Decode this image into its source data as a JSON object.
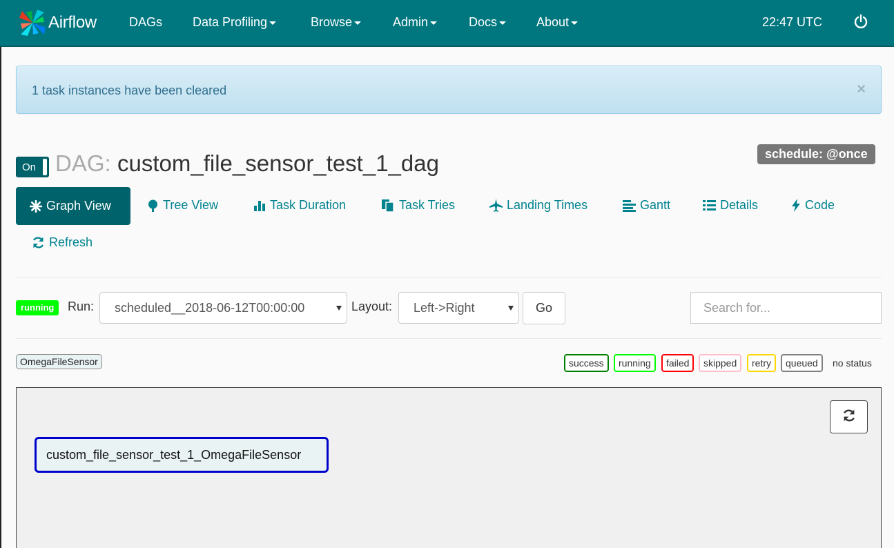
{
  "navbar": {
    "brand": "Airflow",
    "items": [
      {
        "label": "DAGs",
        "dropdown": false
      },
      {
        "label": "Data Profiling",
        "dropdown": true
      },
      {
        "label": "Browse",
        "dropdown": true
      },
      {
        "label": "Admin",
        "dropdown": true
      },
      {
        "label": "Docs",
        "dropdown": true
      },
      {
        "label": "About",
        "dropdown": true
      }
    ],
    "clock": "22:47 UTC",
    "power_icon": "power-icon",
    "color": "#00777f"
  },
  "alert": {
    "message": "1 task instances have been cleared",
    "close": "×"
  },
  "dag": {
    "toggle_label": "On",
    "prefix": "DAG:",
    "name": "custom_file_sensor_test_1_dag",
    "schedule": "schedule: @once"
  },
  "tabs": [
    {
      "label": "Graph View",
      "icon": "asterisk-icon",
      "active": true
    },
    {
      "label": "Tree View",
      "icon": "tree-icon"
    },
    {
      "label": "Task Duration",
      "icon": "bar-chart-icon"
    },
    {
      "label": "Task Tries",
      "icon": "duplicate-icon"
    },
    {
      "label": "Landing Times",
      "icon": "plane-icon"
    },
    {
      "label": "Gantt",
      "icon": "gantt-icon"
    },
    {
      "label": "Details",
      "icon": "list-icon"
    },
    {
      "label": "Code",
      "icon": "flash-icon"
    },
    {
      "label": "Refresh",
      "icon": "refresh-icon"
    }
  ],
  "controls": {
    "state": "running",
    "run_label": "Run:",
    "run_value": "scheduled__2018-06-12T00:00:00",
    "layout_label": "Layout:",
    "layout_value": "Left->Right",
    "go_label": "Go",
    "search_placeholder": "Search for..."
  },
  "operators": [
    "OmegaFileSensor"
  ],
  "legend": [
    {
      "label": "success",
      "color": "#008000"
    },
    {
      "label": "running",
      "color": "#00ff00"
    },
    {
      "label": "failed",
      "color": "#ff0000"
    },
    {
      "label": "skipped",
      "color": "#ffc0cb"
    },
    {
      "label": "retry",
      "color": "#ffd700"
    },
    {
      "label": "queued",
      "color": "#808080"
    },
    {
      "label": "no status",
      "color": "transparent"
    }
  ],
  "graph": {
    "task": "custom_file_sensor_test_1_OmegaFileSensor",
    "task_border": "#0000cc"
  }
}
